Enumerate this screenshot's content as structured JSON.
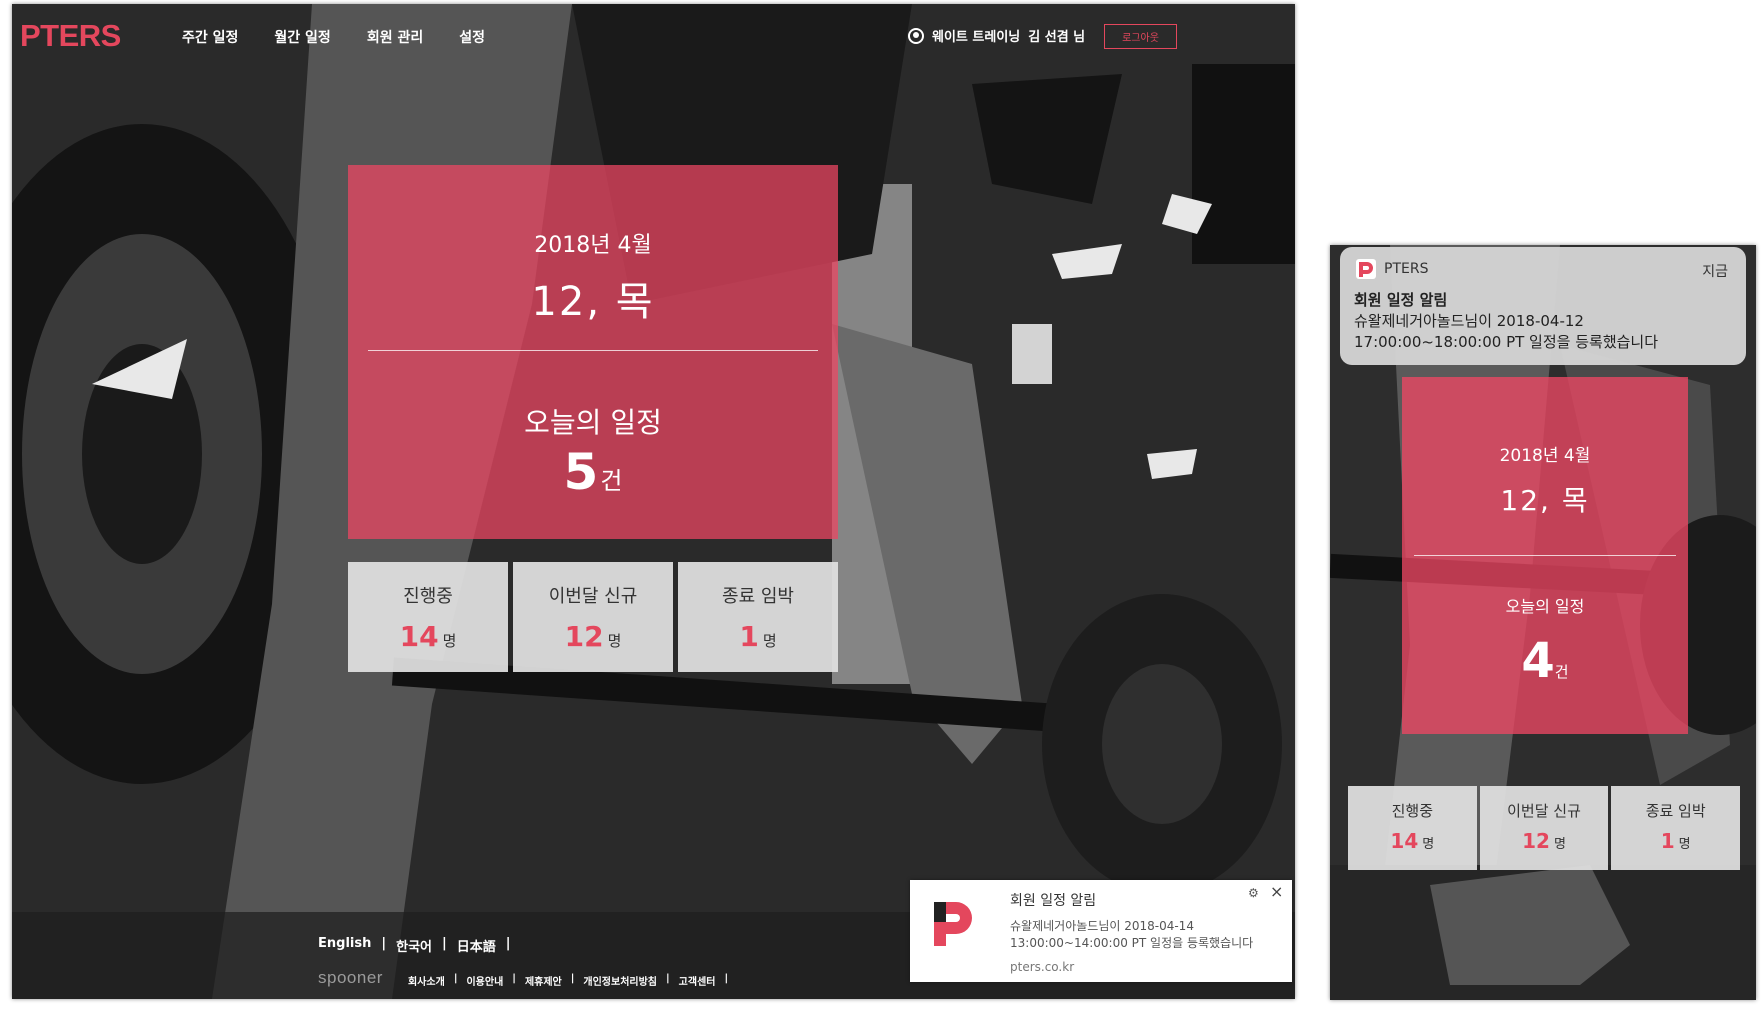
{
  "desktop": {
    "logo": "PTERS",
    "nav": [
      "주간 일정",
      "월간 일정",
      "회원 관리",
      "설정"
    ],
    "user": {
      "program": "웨이트 트레이닝",
      "name": "김 선겸 님"
    },
    "logout": "로그아웃",
    "card": {
      "year_month": "2018년 4월",
      "day": "12, 목",
      "today_label": "오늘의 일정",
      "count": "5",
      "count_unit": "건"
    },
    "stats": [
      {
        "label": "진행중",
        "value": "14",
        "unit": "명"
      },
      {
        "label": "이번달 신규",
        "value": "12",
        "unit": "명"
      },
      {
        "label": "종료 임박",
        "value": "1",
        "unit": "명"
      }
    ],
    "footer": {
      "languages": [
        "English",
        "한국어",
        "日本語"
      ],
      "brand": "spooner",
      "links": [
        "회사소개",
        "이용안내",
        "제휴제안",
        "개인정보처리방침",
        "고객센터"
      ]
    },
    "notification": {
      "title": "회원 일정 알림",
      "body_line1": "슈왈제네거아놀드님이 2018-04-14",
      "body_line2": "13:00:00~14:00:00 PT 일정을 등록했습니다",
      "site": "pters.co.kr"
    }
  },
  "mobile": {
    "notification": {
      "app": "PTERS",
      "time": "지금",
      "title": "회원 일정 알림",
      "body_line1": "슈왈제네거아놀드님이 2018-04-12",
      "body_line2": "17:00:00~18:00:00 PT 일정을 등록했습니다"
    },
    "card": {
      "year_month": "2018년 4월",
      "day": "12, 목",
      "today_label": "오늘의 일정",
      "count": "4",
      "count_unit": "건"
    },
    "stats": [
      {
        "label": "진행중",
        "value": "14",
        "unit": "명"
      },
      {
        "label": "이번달 신규",
        "value": "12",
        "unit": "명"
      },
      {
        "label": "종료 임박",
        "value": "1",
        "unit": "명"
      }
    ]
  },
  "colors": {
    "accent": "#e4475d",
    "card": "#ec4663"
  }
}
